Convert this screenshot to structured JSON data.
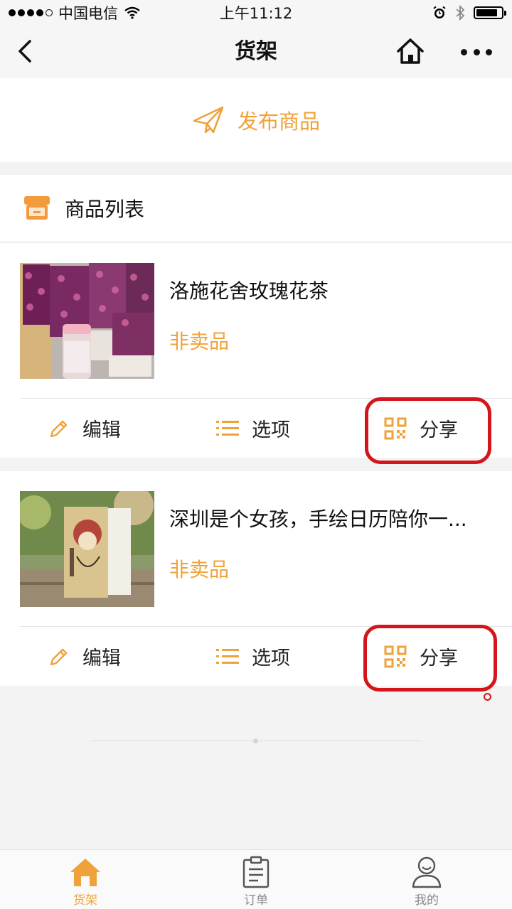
{
  "status_bar": {
    "carrier": "中国电信",
    "time": "上午11:12"
  },
  "nav": {
    "title": "货架"
  },
  "publish": {
    "label": "发布商品"
  },
  "list": {
    "title": "商品列表"
  },
  "products": [
    {
      "name": "洛施花舍玫瑰花茶",
      "status": "非卖品",
      "actions": {
        "edit": "编辑",
        "options": "选项",
        "share": "分享"
      }
    },
    {
      "name": "深圳是个女孩，手绘日历陪你一...",
      "status": "非卖品",
      "actions": {
        "edit": "编辑",
        "options": "选项",
        "share": "分享"
      }
    }
  ],
  "tabs": [
    {
      "label": "货架"
    },
    {
      "label": "订单"
    },
    {
      "label": "我的"
    }
  ],
  "colors": {
    "accent": "#f0a23a",
    "highlight": "#d4151b",
    "background": "#f3f3f3"
  }
}
